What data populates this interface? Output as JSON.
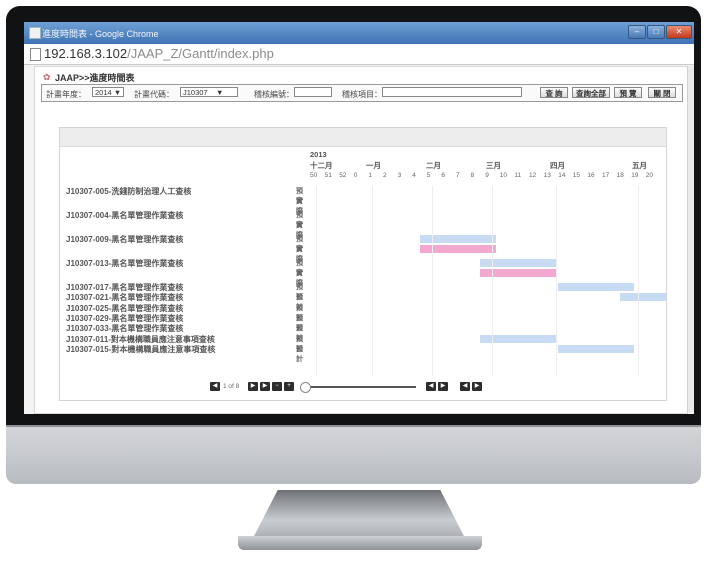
{
  "window": {
    "title": "進度時間表 - Google Chrome",
    "controls": [
      "–",
      "□",
      "✕"
    ]
  },
  "address": {
    "host": "192.168.3.102",
    "path": "/JAAP_Z/Gantt/index.php"
  },
  "breadcrumb": "JAAP>>進度時間表",
  "filters": {
    "year_label": "計畫年度：",
    "year_value": "2014",
    "code_label": "計畫代碼：",
    "code_value": "J10307",
    "id_label": "稽核編號：",
    "id_value": "",
    "item_label": "稽核項目：",
    "item_value": "",
    "btn_query": "查 詢",
    "btn_query_all": "查詢全部",
    "btn_preview": "預 覽",
    "btn_close": "關 閉"
  },
  "timeline": {
    "year": "2013",
    "months": [
      "十二月",
      "一月",
      "二月",
      "三月",
      "四月",
      "五月"
    ],
    "weeks": [
      "50",
      "51",
      "52",
      "0",
      "1",
      "2",
      "3",
      "4",
      "5",
      "6",
      "7",
      "8",
      "9",
      "10",
      "11",
      "12",
      "13",
      "14",
      "15",
      "16",
      "17",
      "18",
      "19",
      "20"
    ]
  },
  "tasks": [
    {
      "name": "J10307-005-洗錢防制治理人工查核",
      "kinds": [
        "預計",
        "實際"
      ]
    },
    {
      "name": "J10307-004-黑名單管理作業查核",
      "kinds": [
        "預計",
        "實際"
      ]
    },
    {
      "name": "J10307-009-黑名單管理作業查核",
      "kinds": [
        "預計",
        "實際"
      ]
    },
    {
      "name": "J10307-013-黑名單管理作業查核",
      "kinds": [
        "預計",
        "實際"
      ]
    },
    {
      "name": "J10307-017-黑名單管理作業查核",
      "kinds": [
        "預計"
      ]
    },
    {
      "name": "J10307-021-黑名單管理作業查核",
      "kinds": [
        "預計"
      ]
    },
    {
      "name": "J10307-025-黑名單管理作業查核",
      "kinds": [
        "預計"
      ]
    },
    {
      "name": "J10307-029-黑名單管理作業查核",
      "kinds": [
        "預計"
      ]
    },
    {
      "name": "J10307-033-黑名單管理作業查核",
      "kinds": [
        "預計"
      ]
    },
    {
      "name": "J10307-011-對本機構職員應注意事項查核",
      "kinds": [
        "預計"
      ]
    },
    {
      "name": "J10307-015-對本機構職員應注意事項查核",
      "kinds": [
        "預計"
      ]
    }
  ],
  "pager": {
    "page_text": "1 of 8"
  },
  "colors": {
    "plan": "#c7dcf3",
    "actual": "#f3a9cf"
  }
}
